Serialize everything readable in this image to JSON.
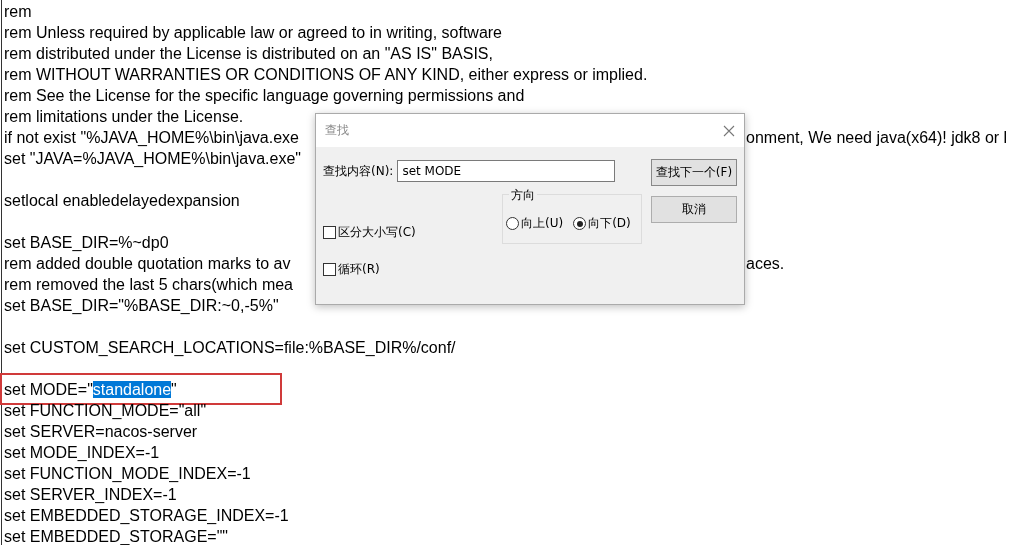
{
  "editor": {
    "blocks": [
      {
        "lines": [
          {
            "text": "rem"
          },
          {
            "text": "rem Unless required by applicable law or agreed to in writing, software"
          },
          {
            "text": "rem distributed under the License is distributed on an \"AS IS\" BASIS,"
          },
          {
            "text": "rem WITHOUT WARRANTIES OR CONDITIONS OF ANY KIND, either express or implied."
          },
          {
            "text": "rem See the License for the specific language governing permissions and"
          },
          {
            "text": "rem limitations under the License."
          },
          {
            "text": "if not exist \"%JAVA_HOME%\\bin\\java.exe",
            "tail": "onment, We need java(x64)! jdk8 or l"
          },
          {
            "text": "set \"JAVA=%JAVA_HOME%\\bin\\java.exe\""
          }
        ]
      },
      {
        "lines": [
          {
            "text": "setlocal enabledelayedexpansion"
          }
        ]
      },
      {
        "lines": [
          {
            "text": "set BASE_DIR=%~dp0"
          },
          {
            "text": "rem added double quotation marks to av",
            "tail": "aces."
          },
          {
            "text": "rem removed the last 5 chars(which mea"
          },
          {
            "text": "set BASE_DIR=\"%BASE_DIR:~0,-5%\""
          }
        ]
      },
      {
        "lines": [
          {
            "text": "set CUSTOM_SEARCH_LOCATIONS=file:%BASE_DIR%/conf/"
          }
        ]
      },
      {
        "lines": [
          {
            "text": "set MODE=\"",
            "selected_text": "standalone",
            "after": "\"",
            "outlined": true
          },
          {
            "text": "set FUNCTION_MODE=\"all\""
          },
          {
            "text": "set SERVER=nacos-server"
          },
          {
            "text": "set MODE_INDEX=-1"
          },
          {
            "text": "set FUNCTION_MODE_INDEX=-1"
          },
          {
            "text": "set SERVER_INDEX=-1"
          },
          {
            "text": "set EMBEDDED_STORAGE_INDEX=-1"
          },
          {
            "text": "set EMBEDDED_STORAGE=\"\""
          }
        ]
      }
    ]
  },
  "find_dialog": {
    "title": "查找",
    "find_label": "查找内容(N):",
    "find_value": "set MODE",
    "options": [
      {
        "label": "区分大小写(C)",
        "checked": false
      },
      {
        "label": "循环(R)",
        "checked": false
      }
    ],
    "direction": {
      "title": "方向",
      "choices": [
        {
          "label": "向上(U)",
          "selected": false
        },
        {
          "label": "向下(D)",
          "selected": true
        }
      ]
    },
    "buttons": [
      {
        "label": "查找下一个(F)",
        "default": true
      },
      {
        "label": "取消",
        "default": false
      }
    ]
  }
}
